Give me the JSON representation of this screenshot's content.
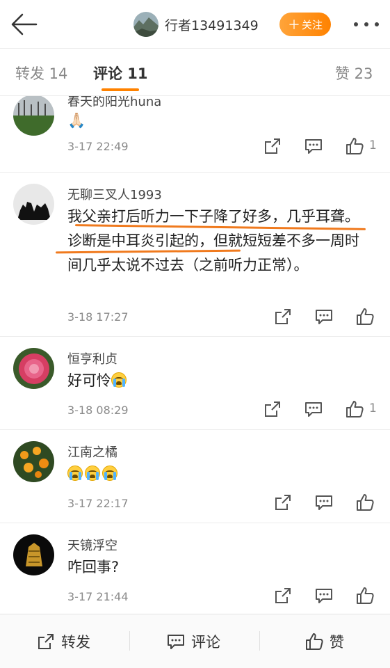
{
  "header": {
    "username": "行者13491349",
    "follow_plus": "＋",
    "follow_label": "关注",
    "back_icon": "back-arrow-icon",
    "more_icon": "more-dots-icon"
  },
  "tabs": {
    "repost": "转发 14",
    "comment": "评论 11",
    "like": "赞 23"
  },
  "comments": [
    {
      "name": "春天的阳光huna",
      "text": "🙏🏻",
      "time": "3-17 22:49",
      "likes": "1"
    },
    {
      "name": "无聊三叉人1993",
      "text": "我父亲打后听力一下子降了好多，几乎耳聋。诊断是中耳炎引起的，但就短短差不多一周时间几乎太说不过去（之前听力正常）。",
      "time": "3-18 17:27",
      "likes": ""
    },
    {
      "name": "恒亨利贞",
      "text": "好可怜",
      "time": "3-18 08:29",
      "likes": "1"
    },
    {
      "name": "江南之橘",
      "text": "",
      "time": "3-17 22:17",
      "likes": ""
    },
    {
      "name": "天镜浮空",
      "text": "咋回事?",
      "time": "3-17 21:44",
      "likes": ""
    }
  ],
  "bottom_bar": {
    "repost": "转发",
    "comment": "评论",
    "like": "赞"
  },
  "colors": {
    "accent": "#ff8200",
    "highlight_line": "#f07a1e"
  }
}
